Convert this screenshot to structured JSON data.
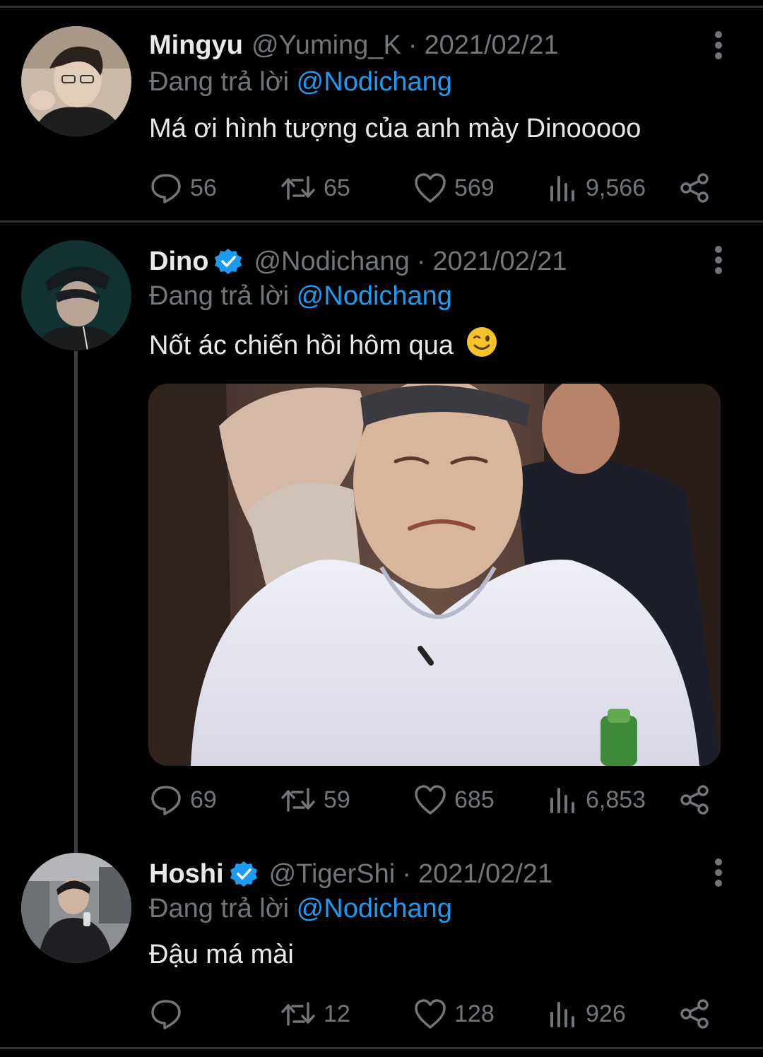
{
  "tweets": [
    {
      "name": "Mingyu",
      "handle": "@Yuming_K",
      "separator": "·",
      "date": "2021/02/21",
      "reply_prefix": "Đang trả lời",
      "reply_to": "@Nodichang",
      "text": "Má ơi hình tượng của anh mày Dinooooo",
      "verified": false,
      "stats": {
        "replies": "56",
        "retweets": "65",
        "likes": "569",
        "views": "9,566"
      }
    },
    {
      "name": "Dino",
      "handle": "@Nodichang",
      "separator": "·",
      "date": "2021/02/21",
      "reply_prefix": "Đang trả lời",
      "reply_to": "@Nodichang",
      "text": "Nốt ác chiến hồi hôm qua",
      "emoji": "winking-face",
      "verified": true,
      "has_media": true,
      "stats": {
        "replies": "69",
        "retweets": "59",
        "likes": "685",
        "views": "6,853"
      }
    },
    {
      "name": "Hoshi",
      "handle": "@TigerShi",
      "separator": "·",
      "date": "2021/02/21",
      "reply_prefix": "Đang trả lời",
      "reply_to": "@Nodichang",
      "text": "Đậu má mài",
      "verified": true,
      "stats": {
        "replies": "",
        "retweets": "12",
        "likes": "128",
        "views": "926"
      }
    }
  ],
  "colors": {
    "background": "#000000",
    "text": "#e7e9ea",
    "secondary": "#71767b",
    "accent": "#1d9bf0",
    "divider": "#2f3336"
  }
}
